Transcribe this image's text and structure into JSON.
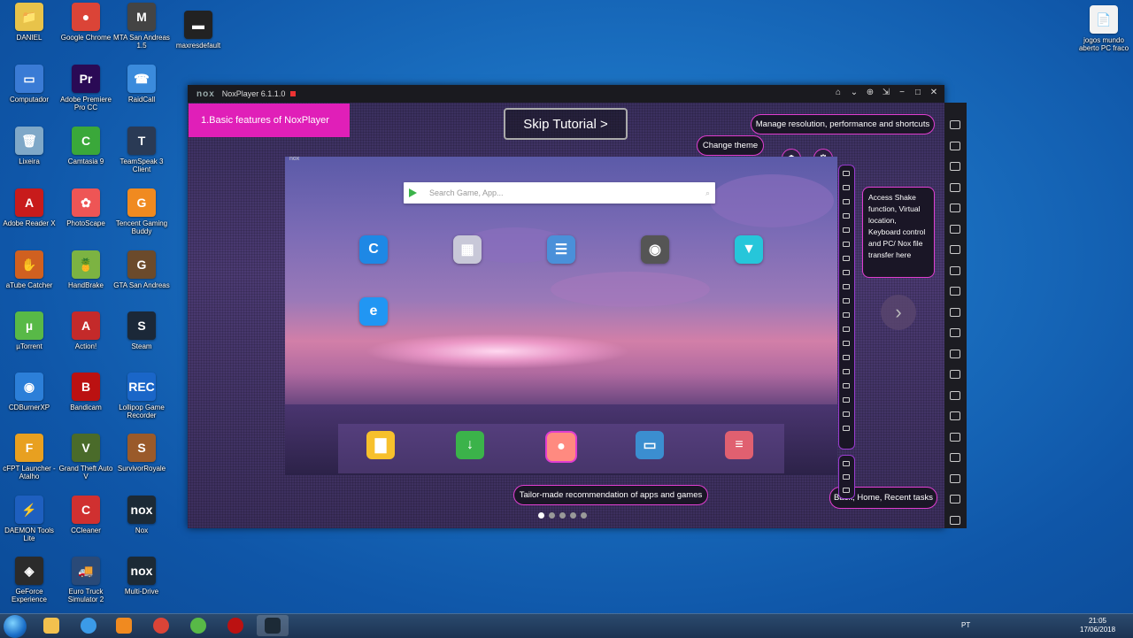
{
  "desktop": {
    "icons": [
      {
        "label": "DANIEL",
        "color": "#e8c34a",
        "glyph": "📁"
      },
      {
        "label": "Google Chrome",
        "color": "#db4437",
        "glyph": "●"
      },
      {
        "label": "MTA San Andreas 1.5",
        "color": "#444",
        "glyph": "M"
      },
      {
        "label": "maxresdefault",
        "color": "#222",
        "glyph": "▬"
      },
      {
        "label": "Computador",
        "color": "#3a7bd5",
        "glyph": "▭"
      },
      {
        "label": "Adobe Premiere Pro CC",
        "color": "#2a0a55",
        "glyph": "Pr"
      },
      {
        "label": "RaidCall",
        "color": "#3b8bdc",
        "glyph": "☎"
      },
      {
        "label": "Lixeira",
        "color": "#7fa8c8",
        "glyph": "🗑"
      },
      {
        "label": "Camtasia 9",
        "color": "#3aa83a",
        "glyph": "C"
      },
      {
        "label": "TeamSpeak 3 Client",
        "color": "#2a3a55",
        "glyph": "T"
      },
      {
        "label": "Adobe Reader X",
        "color": "#c81b1b",
        "glyph": "A"
      },
      {
        "label": "PhotoScape",
        "color": "#e55",
        "glyph": "✿"
      },
      {
        "label": "Tencent Gaming Buddy",
        "color": "#f08a20",
        "glyph": "G"
      },
      {
        "label": "aTube Catcher",
        "color": "#d06020",
        "glyph": "✋"
      },
      {
        "label": "HandBrake",
        "color": "#7cb342",
        "glyph": "🍍"
      },
      {
        "label": "GTA San Andreas",
        "color": "#6b4a2b",
        "glyph": "G"
      },
      {
        "label": "µTorrent",
        "color": "#58b947",
        "glyph": "µ"
      },
      {
        "label": "Action!",
        "color": "#c42a2a",
        "glyph": "A"
      },
      {
        "label": "Steam",
        "color": "#1b2838",
        "glyph": "S"
      },
      {
        "label": "CDBurnerXP",
        "color": "#2c7fd8",
        "glyph": "◉"
      },
      {
        "label": "Bandicam",
        "color": "#b11",
        "glyph": "B"
      },
      {
        "label": "Lollipop Game Recorder",
        "color": "#1a66c8",
        "glyph": "REC"
      },
      {
        "label": "cFPT Launcher - Atalho",
        "color": "#e8a020",
        "glyph": "F"
      },
      {
        "label": "Grand Theft Auto V",
        "color": "#4a6b2a",
        "glyph": "V"
      },
      {
        "label": "SurvivorRoyale",
        "color": "#9a5a2a",
        "glyph": "S"
      },
      {
        "label": "DAEMON Tools Lite",
        "color": "#1e5fbf",
        "glyph": "⚡"
      },
      {
        "label": "CCleaner",
        "color": "#d03030",
        "glyph": "C"
      },
      {
        "label": "Nox",
        "color": "#1c2a36",
        "glyph": "nox"
      },
      {
        "label": "GeForce Experience",
        "color": "#2b2b2b",
        "glyph": "◈"
      },
      {
        "label": "Euro Truck Simulator 2",
        "color": "#2a4a78",
        "glyph": "🚚"
      },
      {
        "label": "Multi-Drive",
        "color": "#1c2a36",
        "glyph": "nox"
      },
      {
        "label": "jogos mundo aberto PC fraco",
        "color": "#f2f2f2",
        "glyph": "📄"
      }
    ]
  },
  "window": {
    "logo": "nox",
    "title": "NoxPlayer 6.1.1.0",
    "controls": [
      "⌂",
      "⌄",
      "⊕",
      "⇲",
      "−",
      "□",
      "✕"
    ]
  },
  "tutorial": {
    "tag": "1.Basic features of NoxPlayer",
    "skip": "Skip Tutorial >",
    "tip_resolution": "Manage resolution, performance and shortcuts",
    "tip_theme": "Change theme",
    "tip_shake": "Access Shake function, Virtual location, Keyboard control and PC/ Nox file transfer here",
    "tip_recommend": "Tailor-made recommendation of apps and games",
    "tip_nav": "Back, Home, Recent tasks"
  },
  "screen": {
    "small_logo": "nox",
    "search_placeholder": "Search Game, App...",
    "search_icon": "⌕",
    "apps": [
      {
        "name": "c-app-icon",
        "color": "#1e88e5",
        "glyph": "C"
      },
      {
        "name": "folder-app-icon",
        "color": "#c8c8d8",
        "glyph": "▦"
      },
      {
        "name": "contacts-app-icon",
        "color": "#4a90d9",
        "glyph": "☰"
      },
      {
        "name": "camera-app-icon",
        "color": "#555",
        "glyph": "◉"
      },
      {
        "name": "gift-app-icon",
        "color": "#26c6da",
        "glyph": "▼"
      },
      {
        "name": "es-explorer-icon",
        "color": "#2196f3",
        "glyph": "e"
      }
    ],
    "dock": [
      {
        "name": "files-icon",
        "color": "#f7c02c",
        "glyph": "▇"
      },
      {
        "name": "download-icon",
        "color": "#3bb34a",
        "glyph": "↓"
      },
      {
        "name": "recommend-icon",
        "color": "#ff8a80",
        "glyph": "●"
      },
      {
        "name": "gallery-icon",
        "color": "#3b8ed0",
        "glyph": "▭"
      },
      {
        "name": "settings-icon",
        "color": "#e06070",
        "glyph": "≡"
      }
    ],
    "next_glyph": "›"
  },
  "taskbar": {
    "lang": "PT",
    "time": "21:05",
    "date": "17/06/2018"
  }
}
